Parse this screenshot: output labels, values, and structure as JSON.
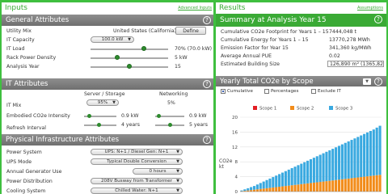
{
  "colors": {
    "accent": "#3aaa35",
    "section": "#7f7f7f",
    "scope1": "#e31e24",
    "scope2": "#f28c1a",
    "scope3": "#3aa9e0"
  },
  "inputs": {
    "title": "Inputs",
    "advanced_link": "Advanced Inputs",
    "general": {
      "title": "General Attributes",
      "utility_mix_label": "Utility Mix",
      "utility_mix_value": "United States (California)",
      "define_button": "Define",
      "it_capacity_label": "IT Capacity",
      "it_capacity_value": "100.0 kW",
      "it_load_label": "IT Load",
      "it_load_value": "70% (70.0 kW)",
      "it_load_level": 0.7,
      "rack_density_label": "Rack Power Density",
      "rack_density_value": "5 kW",
      "rack_density_level": 0.33,
      "analysis_years_label": "Analysis Year",
      "analysis_years_value": "15",
      "analysis_years_level": 0.5
    },
    "it": {
      "title": "IT Attributes",
      "col_server": "Server / Storage",
      "col_network": "Networking",
      "it_mix_label": "IT Mix",
      "it_mix_value": "95%",
      "network_pct": "5%",
      "embodied_label": "Embodied CO2e Intensity",
      "embodied_server_value": "0.9 kW",
      "embodied_network_value": "0.9 kW",
      "refresh_label": "Refresh Interval",
      "refresh_server_value": "4 years",
      "refresh_network_value": "5 years"
    },
    "physical": {
      "title": "Physical Infrastructure Attributes",
      "power_system_label": "Power System",
      "power_system_value": "UPS: N+1 / Diesel Gen: N+1",
      "ups_mode_label": "UPS Mode",
      "ups_mode_value": "Typical Double Conversion",
      "gen_use_label": "Annual Generator Use",
      "gen_use_value": "0 hours",
      "power_dist_label": "Power Distribution",
      "power_dist_value": "208V Busway from Transformer",
      "cooling_label": "Cooling System",
      "cooling_value": "Chilled Water: N+1"
    }
  },
  "results": {
    "title": "Results",
    "assumptions_link": "Assumptions",
    "summary_title": "Summary at Analysis Year 15",
    "rows": [
      {
        "label": "Cumulative CO2e Footprint for Years 1 – 15",
        "value": "7444,048 t"
      },
      {
        "label": "Cumulative Energy for Years 1 – 15",
        "value": "13770,278 MWh"
      },
      {
        "label": "Emission Factor for Year 15",
        "value": "341,360 kg/MWh"
      },
      {
        "label": "Average Annual PUE",
        "value": "0.02"
      },
      {
        "label": "Estimated Building Size",
        "value": "126,890 m² (1365,828"
      }
    ],
    "chart_title": "Yearly Total CO2e by Scope",
    "cumulative_label": "Cumulative",
    "percentages_label": "Percentages",
    "exclude_it_label": "Exclude IT"
  },
  "chart_data": {
    "type": "bar",
    "stacked": true,
    "ylabel": "CO2e\nkt",
    "ylim": [
      0,
      20
    ],
    "yticks": [
      "20",
      "16",
      "12",
      "8",
      "4",
      "0"
    ],
    "series": [
      {
        "name": "Scope 1",
        "values": [
          0,
          0,
          0,
          0,
          0,
          0,
          0,
          0,
          0,
          0,
          0,
          0,
          0,
          0,
          0,
          0,
          0,
          0,
          0,
          0,
          0,
          0,
          0,
          0,
          0,
          0,
          0,
          0,
          0,
          0,
          0,
          0,
          0,
          0,
          0,
          0,
          0,
          0,
          0,
          0,
          0,
          0,
          0,
          0,
          0
        ]
      },
      {
        "name": "Scope 2",
        "values": [
          0.1,
          0.2,
          0.3,
          0.4,
          0.5,
          0.6,
          0.7,
          0.8,
          0.9,
          1.0,
          1.1,
          1.2,
          1.3,
          1.4,
          1.5,
          1.6,
          1.7,
          1.8,
          1.9,
          2.0,
          2.1,
          2.2,
          2.3,
          2.4,
          2.5,
          2.6,
          2.7,
          2.8,
          2.9,
          3.0,
          3.1,
          3.2,
          3.3,
          3.4,
          3.5,
          3.6,
          3.7,
          3.8,
          3.9,
          4.0,
          4.1,
          4.2,
          4.3,
          4.4,
          4.5
        ]
      },
      {
        "name": "Scope 3",
        "values": [
          0.2,
          0.4,
          0.6,
          0.8,
          1.0,
          1.3,
          1.6,
          1.9,
          2.2,
          2.5,
          2.8,
          3.1,
          3.4,
          3.7,
          4.0,
          4.3,
          4.6,
          4.9,
          5.2,
          5.5,
          5.8,
          6.1,
          6.4,
          6.7,
          7.0,
          7.3,
          7.6,
          7.9,
          8.2,
          8.5,
          8.8,
          9.1,
          9.4,
          9.7,
          10.0,
          10.3,
          10.6,
          10.9,
          11.2,
          11.5,
          11.8,
          12.1,
          12.4,
          12.8,
          13.2
        ]
      }
    ]
  }
}
